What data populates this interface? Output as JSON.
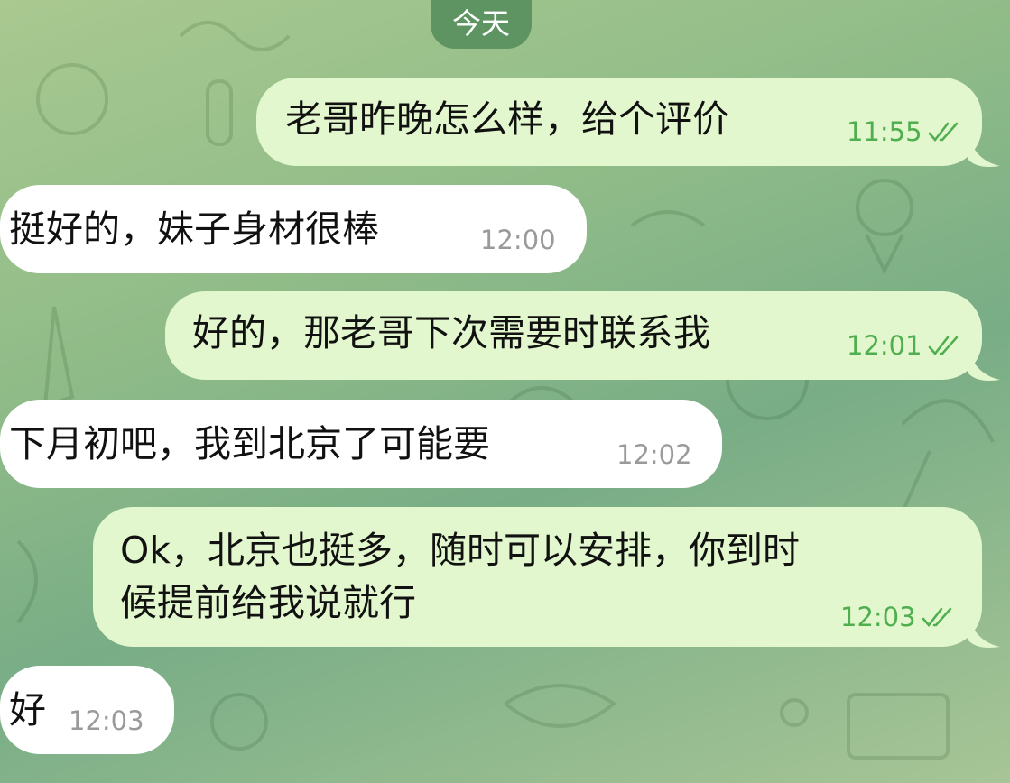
{
  "date_separator": "今天",
  "messages": [
    {
      "direction": "out",
      "text": "老哥昨晚怎么样，给个评价",
      "time": "11:55",
      "read_icon": "double-check-icon"
    },
    {
      "direction": "in",
      "text": "挺好的，妹子身材很棒",
      "time": "12:00"
    },
    {
      "direction": "out",
      "text": "好的，那老哥下次需要时联系我",
      "time": "12:01",
      "read_icon": "double-check-icon"
    },
    {
      "direction": "in",
      "text": "下月初吧，我到北京了可能要",
      "time": "12:02"
    },
    {
      "direction": "out",
      "text_line1": "Ok，北京也挺多，随时可以安排，你到时",
      "text_line2": "候提前给我说就行",
      "time": "12:03",
      "read_icon": "double-check-icon"
    },
    {
      "direction": "in",
      "text": "好",
      "time": "12:03"
    }
  ],
  "colors": {
    "outgoing_bubble": "#e2f7cd",
    "incoming_bubble": "#ffffff",
    "outgoing_meta": "#4fae4e",
    "incoming_meta": "#9a9a9a",
    "date_pill": "#5e9462"
  }
}
